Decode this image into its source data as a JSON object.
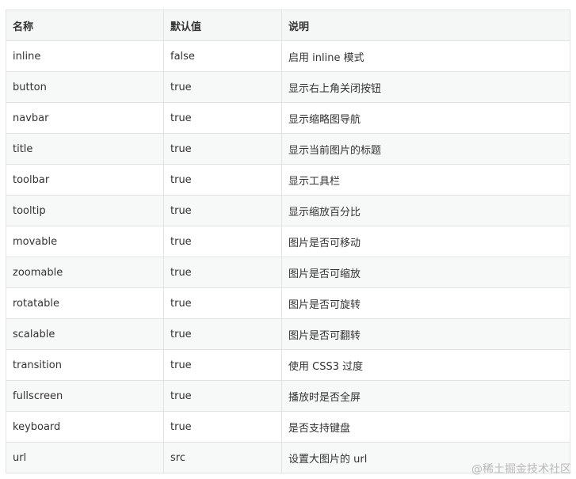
{
  "table": {
    "headers": [
      "名称",
      "默认值",
      "说明"
    ],
    "rows": [
      [
        "inline",
        "false",
        "启用 inline 模式"
      ],
      [
        "button",
        "true",
        "显示右上角关闭按钮"
      ],
      [
        "navbar",
        "true",
        "显示缩略图导航"
      ],
      [
        "title",
        "true",
        "显示当前图片的标题"
      ],
      [
        "toolbar",
        "true",
        "显示工具栏"
      ],
      [
        "tooltip",
        "true",
        "显示缩放百分比"
      ],
      [
        "movable",
        "true",
        "图片是否可移动"
      ],
      [
        "zoomable",
        "true",
        "图片是否可缩放"
      ],
      [
        "rotatable",
        "true",
        "图片是否可旋转"
      ],
      [
        "scalable",
        "true",
        "图片是否可翻转"
      ],
      [
        "transition",
        "true",
        "使用 CSS3 过度"
      ],
      [
        "fullscreen",
        "true",
        "播放时是否全屏"
      ],
      [
        "keyboard",
        "true",
        "是否支持键盘"
      ],
      [
        "url",
        "src",
        "设置大图片的 url"
      ]
    ]
  },
  "watermark": "@稀土掘金技术社区"
}
